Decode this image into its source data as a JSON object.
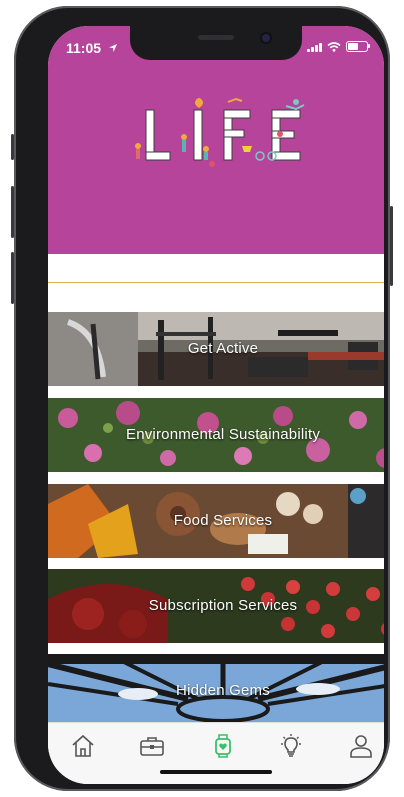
{
  "status_bar": {
    "time": "11:05"
  },
  "header": {
    "logo_text": "LIFE",
    "background_color": "#b5449a"
  },
  "categories": [
    {
      "label": "Get Active",
      "image": "gym-equipment"
    },
    {
      "label": "Environmental Sustainability",
      "image": "pink-flowers"
    },
    {
      "label": "Food Services",
      "image": "pastries"
    },
    {
      "label": "Subscription Services",
      "image": "red-flowers"
    },
    {
      "label": "Hidden Gems",
      "image": "pavilion-sky"
    }
  ],
  "tabbar": {
    "items": [
      {
        "icon": "home-icon",
        "active": false
      },
      {
        "icon": "briefcase-icon",
        "active": false
      },
      {
        "icon": "watch-heart-icon",
        "active": true
      },
      {
        "icon": "lightbulb-icon",
        "active": false
      },
      {
        "icon": "profile-icon",
        "active": false
      }
    ],
    "active_color": "#3dbf6a"
  }
}
